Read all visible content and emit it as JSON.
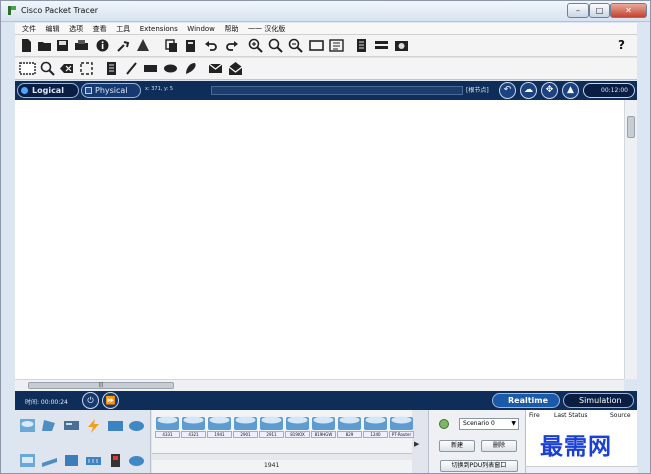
{
  "window": {
    "title": "Cisco Packet Tracer",
    "min": "–",
    "max": "□",
    "close": "✕"
  },
  "menubar": {
    "items": [
      "文件",
      "编辑",
      "选项",
      "查看",
      "工具",
      "Extensions",
      "Window",
      "帮助",
      "一一 汉化版"
    ]
  },
  "toolbar1": {
    "icons": [
      "new-file-icon",
      "open-folder-icon",
      "save-icon",
      "print-icon",
      "info-icon",
      "activity-wizard-icon",
      "network-info-icon",
      "copy-icon",
      "paste-icon",
      "undo-icon",
      "redo-icon",
      "zoom-in-icon",
      "zoom-reset-icon",
      "zoom-out-icon",
      "rectangle-tool-icon",
      "palette-icon",
      "custom-device-icon",
      "device-icon",
      "screenshot-icon"
    ],
    "help": "?"
  },
  "toolbar2": {
    "icons": [
      "select-tool-icon",
      "inspect-icon",
      "delete-icon",
      "resize-icon",
      "note-icon",
      "line-icon",
      "rectangle-icon",
      "ellipse-icon",
      "freeform-icon",
      "simple-pdu-icon",
      "complex-pdu-icon"
    ]
  },
  "nav": {
    "logical": "Logical",
    "physical": "Physical",
    "coords": "x: 371, y: 5",
    "root": "[根节点]",
    "clock": "00:12:00"
  },
  "timebar": {
    "label": "时间: 00:00:24",
    "realtime": "Realtime",
    "simulation": "Simulation"
  },
  "devices": {
    "categories": [
      "router-category-icon",
      "switch-category-icon",
      "hub-category-icon",
      "wireless-category-icon",
      "security-category-icon",
      "wan-emulation-icon",
      "end-device-icon",
      "custom-device-icon",
      "multiuser-icon",
      "connections-icon",
      "components-icon",
      "cloud-icon"
    ],
    "models": [
      "4331",
      "4321",
      "1941",
      "2901",
      "2911",
      "819IOX",
      "819HGW",
      "829",
      "1240",
      "PT-Router"
    ],
    "selected": "1941"
  },
  "scenario": {
    "select": "Scenario 0",
    "new": "新建",
    "delete": "删除",
    "pdu_list": "切换到PDU列表窗口"
  },
  "pdu": {
    "columns": [
      "Fire",
      "Last Status",
      "Source"
    ]
  },
  "watermark": "最需网"
}
